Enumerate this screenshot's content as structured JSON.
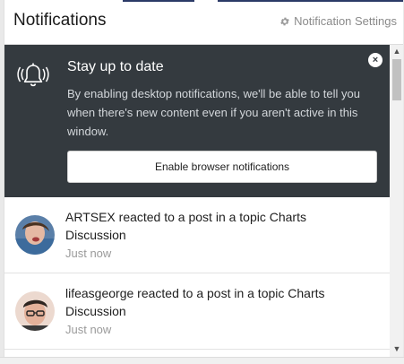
{
  "header": {
    "title": "Notifications",
    "settings_label": "Notification Settings"
  },
  "promo": {
    "title": "Stay up to date",
    "text": "By enabling desktop notifications, we'll be able to tell you when there's new content even if you aren't active in this window.",
    "button_label": "Enable browser notifications",
    "close_label": "×"
  },
  "notifications": [
    {
      "text": "ARTSEX reacted to a post in a topic Charts Discussion",
      "time": "Just now"
    },
    {
      "text": "lifeasgeorge reacted to a post in a topic Charts Discussion",
      "time": "Just now"
    }
  ],
  "scrollbar": {
    "up": "▲",
    "down": "▼"
  },
  "colors": {
    "promo_bg": "#343a3f",
    "accent_strip": "#2b3a67",
    "muted": "#8a8a8a"
  }
}
